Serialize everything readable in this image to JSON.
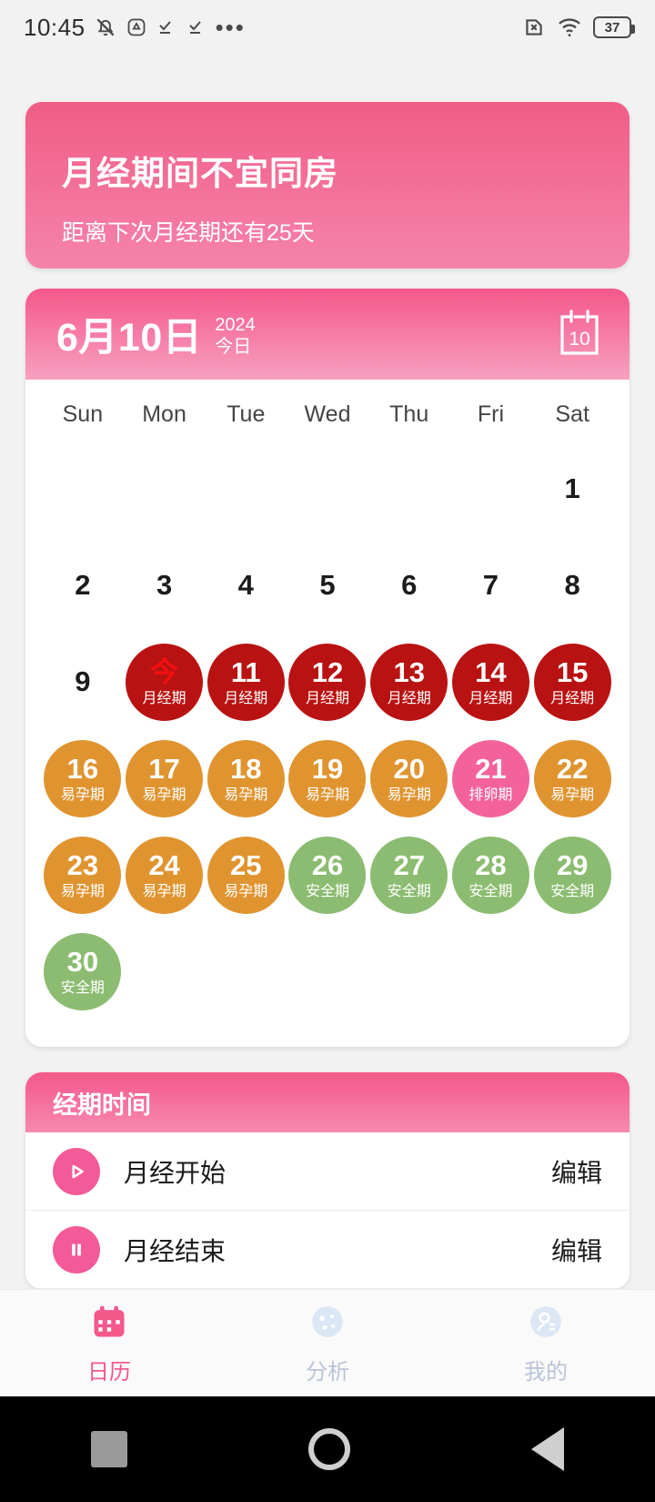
{
  "status_bar": {
    "time": "10:45",
    "battery_percent": "37",
    "left_icons": [
      "mute-bell-icon",
      "triangle-app-icon",
      "check-underline-icon",
      "check-underline-icon",
      "more-dots-icon"
    ],
    "right_icons": [
      "no-sim-icon",
      "wifi-icon",
      "battery-icon"
    ]
  },
  "banner": {
    "title": "月经期间不宜同房",
    "subtitle": "距离下次月经期还有25天"
  },
  "calendar": {
    "date_title": "6月10日",
    "year": "2024",
    "today_label": "今日",
    "icon_day": "10",
    "weekdays": [
      "Sun",
      "Mon",
      "Tue",
      "Wed",
      "Thu",
      "Fri",
      "Sat"
    ],
    "leading_blanks": 6,
    "colors": {
      "period": "#b91212",
      "fertile": "#e09430",
      "ovulation": "#f4629c",
      "safe": "#8cbc71",
      "accent": "#f4588a"
    },
    "days": [
      {
        "num": "1",
        "label": "",
        "type": "plain"
      },
      {
        "num": "2",
        "label": "",
        "type": "plain"
      },
      {
        "num": "3",
        "label": "",
        "type": "plain"
      },
      {
        "num": "4",
        "label": "",
        "type": "plain"
      },
      {
        "num": "5",
        "label": "",
        "type": "plain"
      },
      {
        "num": "6",
        "label": "",
        "type": "plain"
      },
      {
        "num": "7",
        "label": "",
        "type": "plain"
      },
      {
        "num": "8",
        "label": "",
        "type": "plain"
      },
      {
        "num": "9",
        "label": "",
        "type": "plain"
      },
      {
        "num": "今",
        "label": "月经期",
        "type": "period",
        "today": true
      },
      {
        "num": "11",
        "label": "月经期",
        "type": "period"
      },
      {
        "num": "12",
        "label": "月经期",
        "type": "period"
      },
      {
        "num": "13",
        "label": "月经期",
        "type": "period"
      },
      {
        "num": "14",
        "label": "月经期",
        "type": "period"
      },
      {
        "num": "15",
        "label": "月经期",
        "type": "period"
      },
      {
        "num": "16",
        "label": "易孕期",
        "type": "fertile"
      },
      {
        "num": "17",
        "label": "易孕期",
        "type": "fertile"
      },
      {
        "num": "18",
        "label": "易孕期",
        "type": "fertile"
      },
      {
        "num": "19",
        "label": "易孕期",
        "type": "fertile"
      },
      {
        "num": "20",
        "label": "易孕期",
        "type": "fertile"
      },
      {
        "num": "21",
        "label": "排卵期",
        "type": "ovulation"
      },
      {
        "num": "22",
        "label": "易孕期",
        "type": "fertile"
      },
      {
        "num": "23",
        "label": "易孕期",
        "type": "fertile"
      },
      {
        "num": "24",
        "label": "易孕期",
        "type": "fertile"
      },
      {
        "num": "25",
        "label": "易孕期",
        "type": "fertile"
      },
      {
        "num": "26",
        "label": "安全期",
        "type": "safe"
      },
      {
        "num": "27",
        "label": "安全期",
        "type": "safe"
      },
      {
        "num": "28",
        "label": "安全期",
        "type": "safe"
      },
      {
        "num": "29",
        "label": "安全期",
        "type": "safe"
      },
      {
        "num": "30",
        "label": "安全期",
        "type": "safe"
      }
    ]
  },
  "period_section": {
    "title": "经期时间",
    "rows": [
      {
        "icon": "play-circle-icon",
        "label": "月经开始",
        "action": "编辑"
      },
      {
        "icon": "pause-circle-icon",
        "label": "月经结束",
        "action": "编辑"
      }
    ]
  },
  "bottom_nav": {
    "items": [
      {
        "label": "日历",
        "icon": "calendar-icon",
        "active": true
      },
      {
        "label": "分析",
        "icon": "analysis-icon",
        "active": false
      },
      {
        "label": "我的",
        "icon": "profile-icon",
        "active": false
      }
    ]
  },
  "system_nav": {
    "items": [
      "recents-square-icon",
      "home-circle-icon",
      "back-triangle-icon"
    ]
  }
}
